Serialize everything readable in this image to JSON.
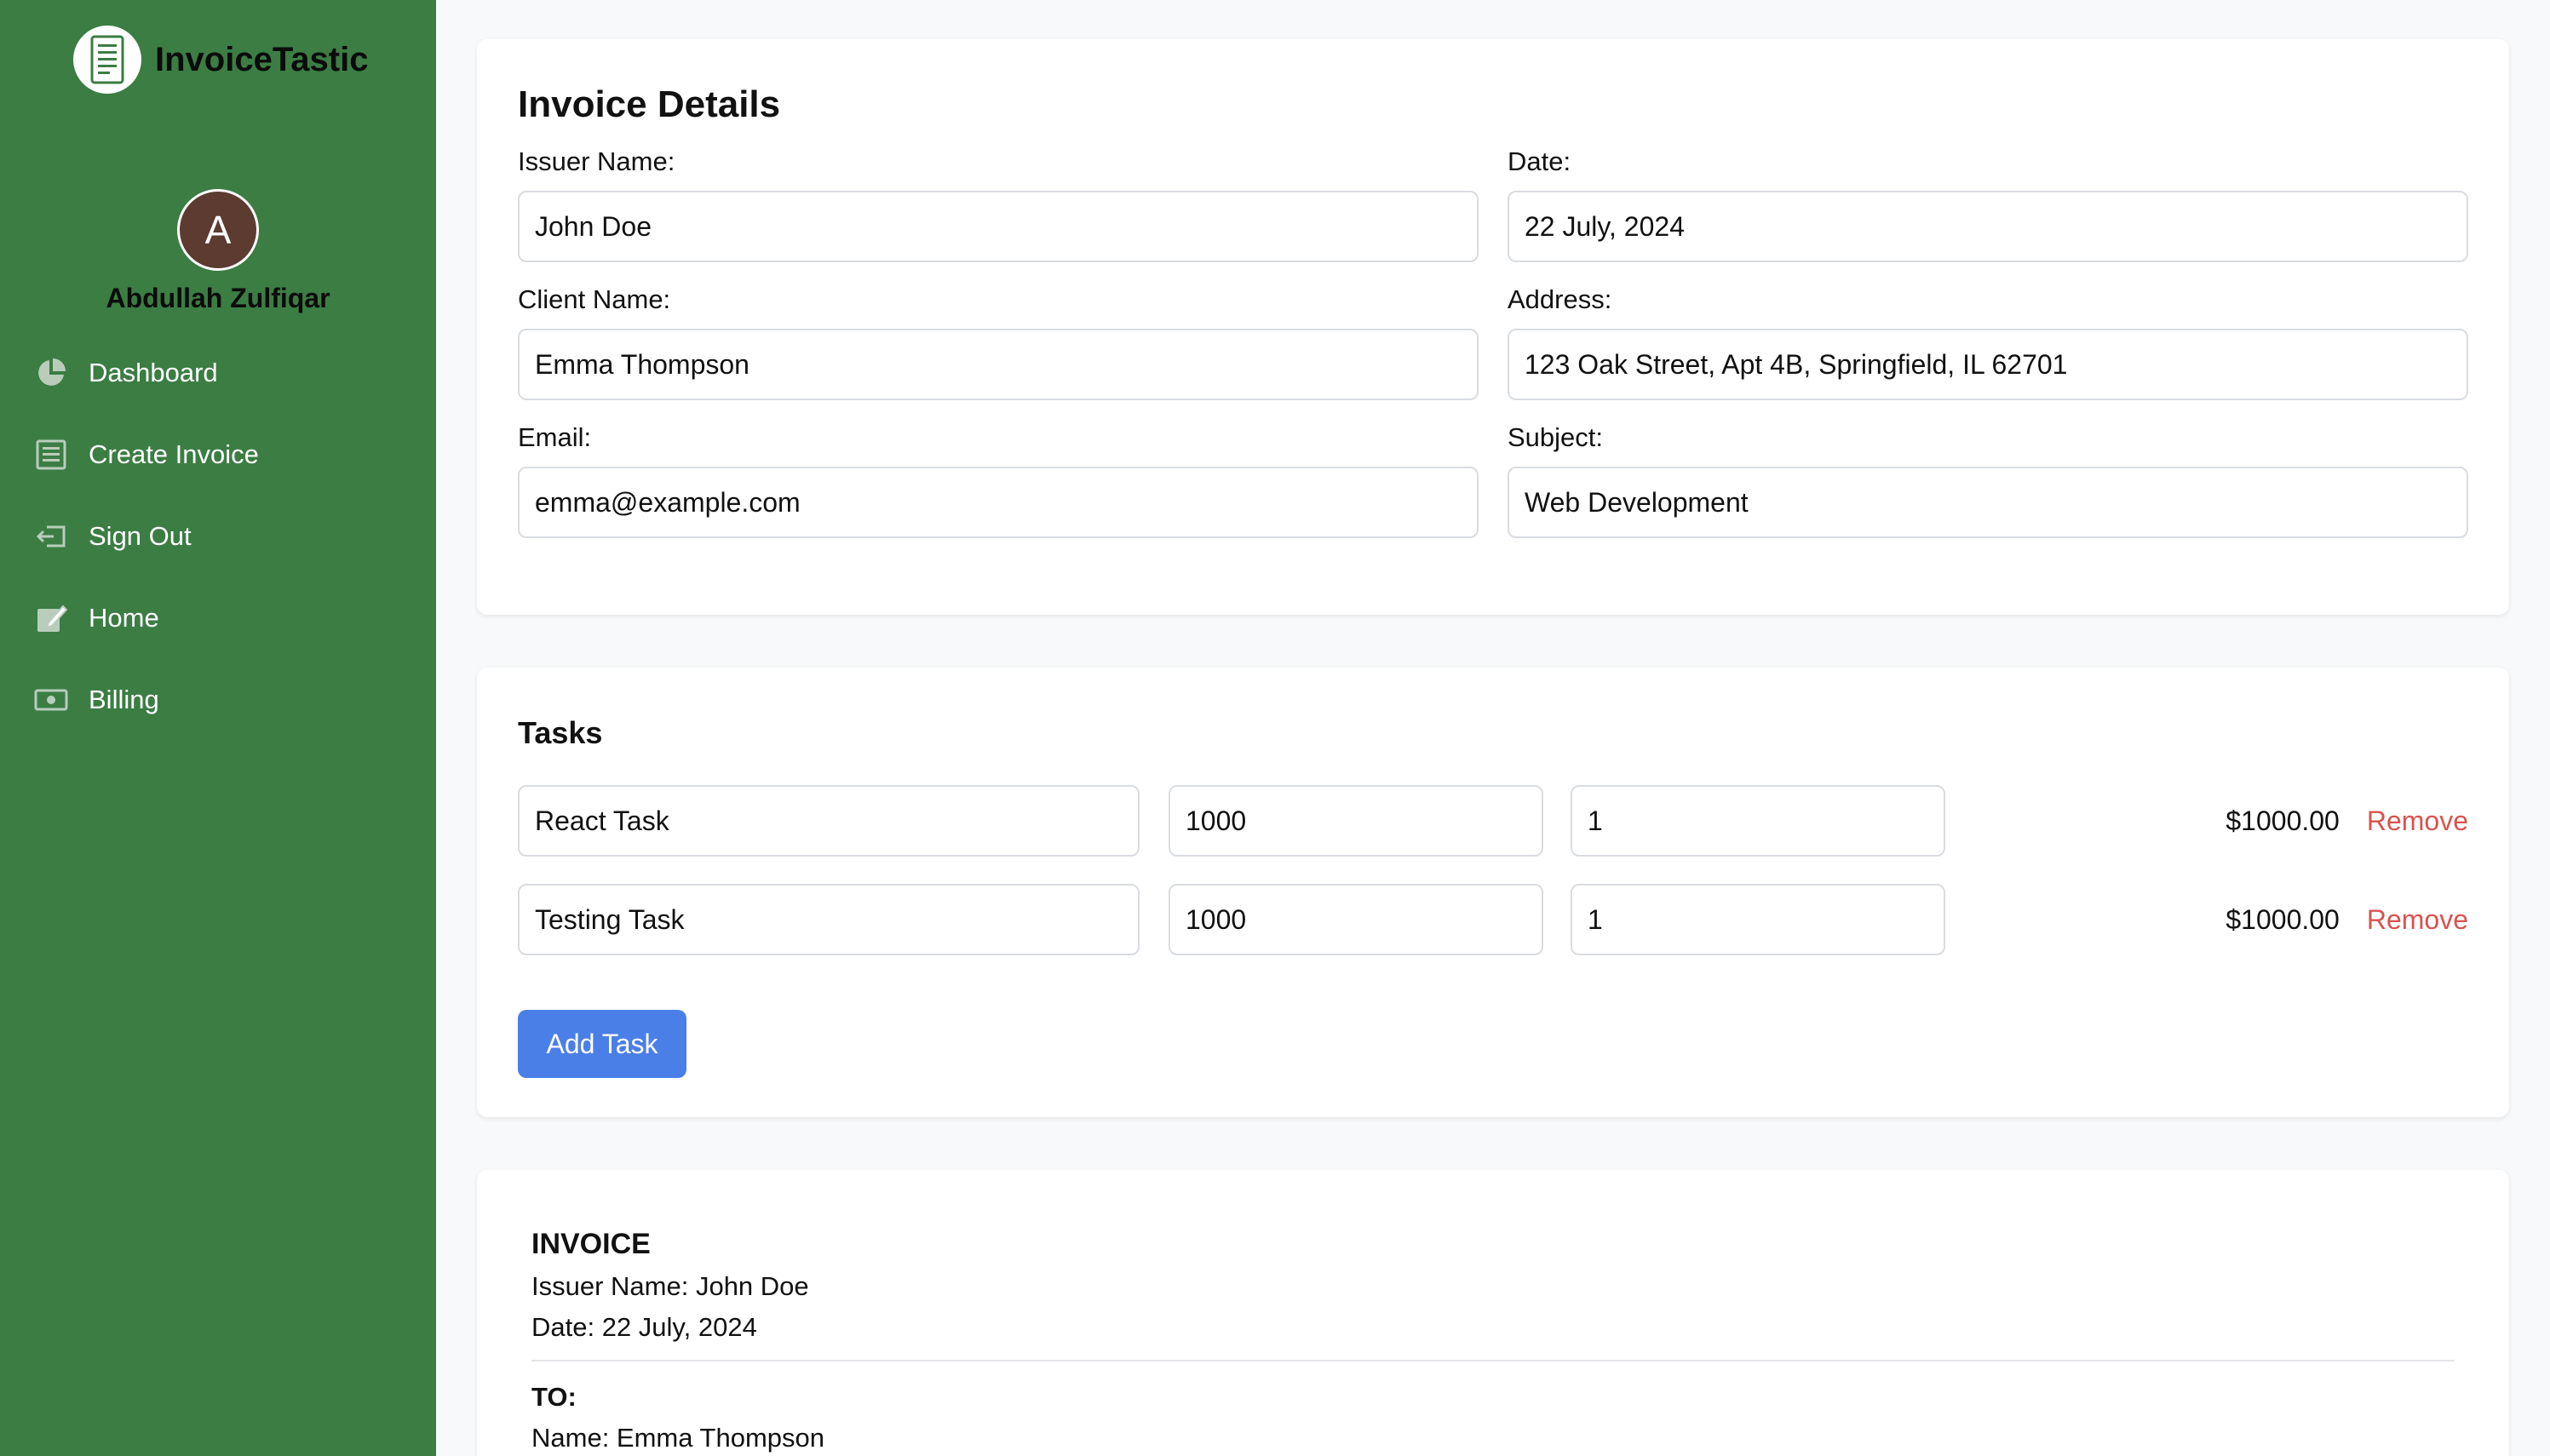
{
  "brand": {
    "name": "InvoiceTastic"
  },
  "user": {
    "initial": "A",
    "name": "Abdullah Zulfiqar"
  },
  "nav": [
    {
      "label": "Dashboard",
      "icon": "pie-chart-icon"
    },
    {
      "label": "Create Invoice",
      "icon": "invoice-list-icon"
    },
    {
      "label": "Sign Out",
      "icon": "sign-out-icon"
    },
    {
      "label": "Home",
      "icon": "edit-home-icon"
    },
    {
      "label": "Billing",
      "icon": "money-icon"
    }
  ],
  "details": {
    "title": "Invoice Details",
    "issuer_label": "Issuer Name:",
    "issuer_value": "John Doe",
    "date_label": "Date:",
    "date_value": "22 July, 2024",
    "client_label": "Client Name:",
    "client_value": "Emma Thompson",
    "address_label": "Address:",
    "address_value": "123 Oak Street, Apt 4B, Springfield, IL 62701",
    "email_label": "Email:",
    "email_value": "emma@example.com",
    "subject_label": "Subject:",
    "subject_value": "Web Development"
  },
  "tasks": {
    "title": "Tasks",
    "items": [
      {
        "name": "React Task",
        "rate": "1000",
        "qty": "1",
        "amount": "$1000.00",
        "remove": "Remove"
      },
      {
        "name": "Testing Task",
        "rate": "1000",
        "qty": "1",
        "amount": "$1000.00",
        "remove": "Remove"
      }
    ],
    "add_label": "Add Task"
  },
  "preview": {
    "heading": "INVOICE",
    "issuer_line": "Issuer Name: John Doe",
    "date_line": "Date: 22 July, 2024",
    "to_heading": "TO:",
    "client_line": "Name: Emma Thompson"
  },
  "colors": {
    "sidebar": "#3b7d43",
    "accent": "#4a7fe8",
    "danger": "#d9534f",
    "avatar": "#5d3b30"
  }
}
